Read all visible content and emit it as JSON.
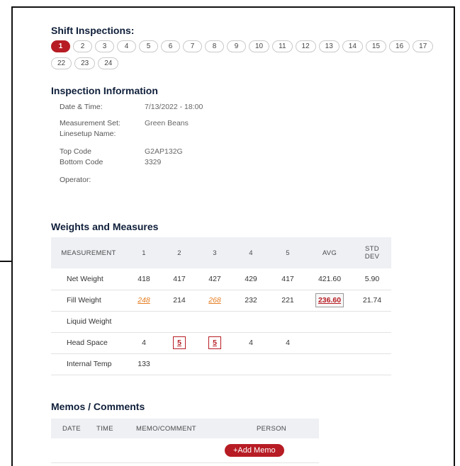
{
  "shift": {
    "title": "Shift Inspections:",
    "pills_row1": [
      "1",
      "2",
      "3",
      "4",
      "5",
      "6",
      "7",
      "8",
      "9",
      "10",
      "11",
      "12",
      "13",
      "14",
      "15",
      "16",
      "17"
    ],
    "pills_row2": [
      "22",
      "23",
      "24"
    ],
    "active": "1"
  },
  "info": {
    "title": "Inspection Information",
    "date_label": "Date & Time:",
    "date_value": "7/13/2022 - 18:00",
    "measurement_set_label": "Measurement Set:",
    "measurement_set_value": "Green Beans",
    "linesetup_label": "Linesetup Name:",
    "top_code_label": "Top Code",
    "top_code_value": "G2AP132G",
    "bottom_code_label": "Bottom Code",
    "bottom_code_value": "3329",
    "operator_label": "Operator:"
  },
  "weights": {
    "title": "Weights and Measures",
    "headers": [
      "MEASUREMENT",
      "1",
      "2",
      "3",
      "4",
      "5",
      "AVG",
      "STD DEV"
    ],
    "std_dev_line1": "STD",
    "std_dev_line2": "DEV",
    "rows": [
      {
        "name": "Net Weight",
        "v1": "418",
        "v2": "417",
        "v3": "427",
        "v4": "429",
        "v5": "417",
        "avg": "421.60",
        "std": "5.90"
      },
      {
        "name": "Fill Weight",
        "v1": "248",
        "v2": "214",
        "v3": "268",
        "v4": "232",
        "v5": "221",
        "avg": "236.60",
        "std": "21.74"
      },
      {
        "name": "Liquid Weight"
      },
      {
        "name": "Head Space",
        "v1": "4",
        "v2": "5",
        "v3": "5",
        "v4": "4",
        "v5": "4"
      },
      {
        "name": "Internal Temp",
        "v1": "133"
      }
    ]
  },
  "memos": {
    "title": "Memos / Comments",
    "headers": {
      "date": "DATE",
      "time": "TIME",
      "memo": "MEMO/COMMENT",
      "person": "PERSON"
    },
    "add_button": "+Add Memo"
  },
  "colors": {
    "accent": "#b71c24",
    "warning": "#e67e22",
    "header_bg": "#eef0f4",
    "title": "#0f1f3a"
  }
}
